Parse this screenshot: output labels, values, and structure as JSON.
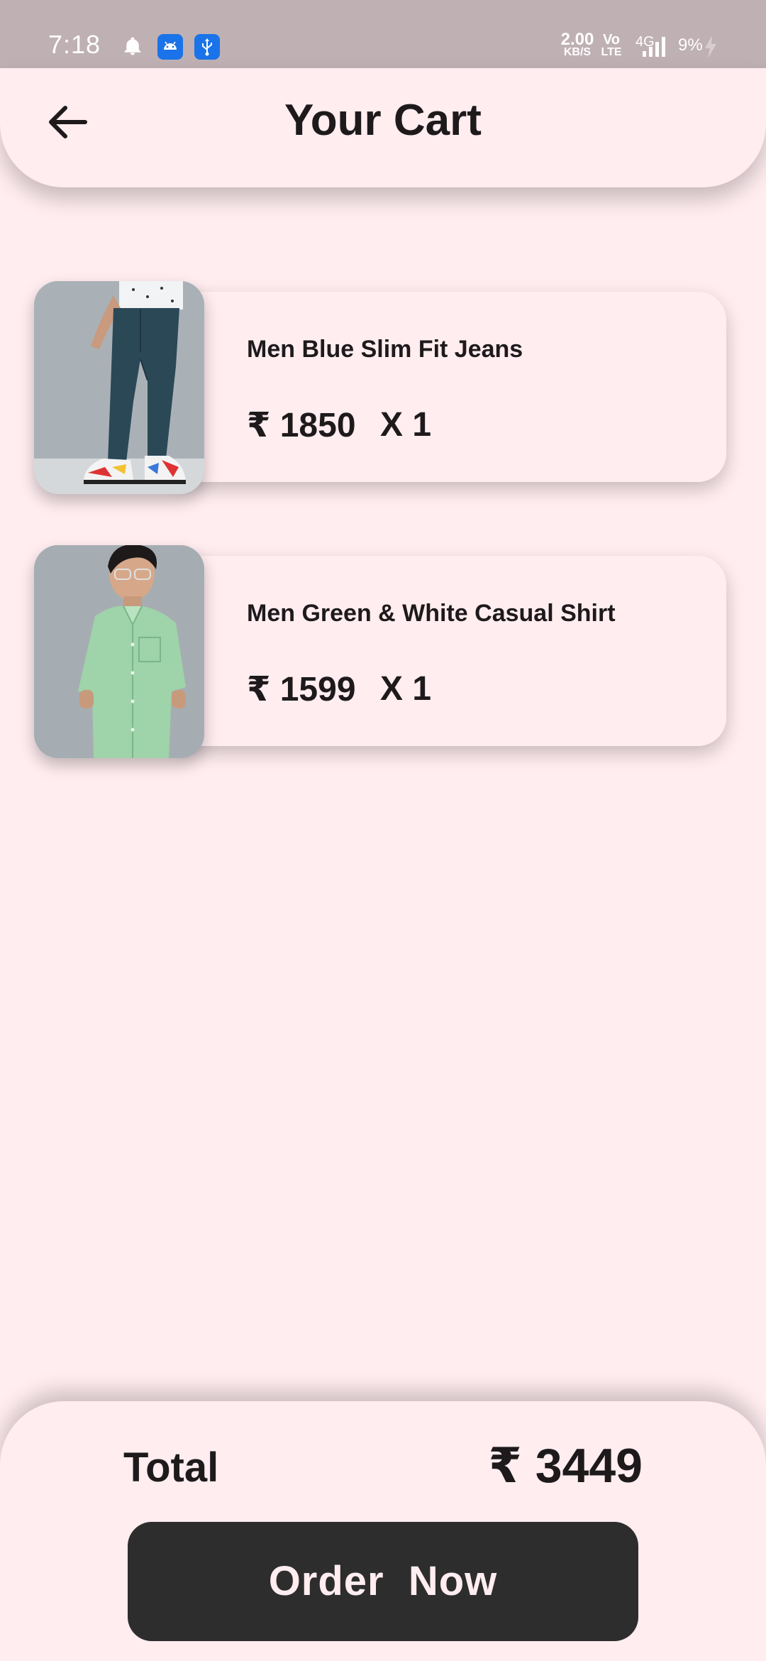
{
  "status_bar": {
    "time": "7:18",
    "speed_value": "2.00",
    "speed_unit": "KB/S",
    "volte_top": "Vo",
    "volte_bottom": "LTE",
    "network": "4G",
    "battery": "9%",
    "icons": [
      "bell-icon",
      "android-icon",
      "usb-icon",
      "signal-icon",
      "charging-icon"
    ]
  },
  "header": {
    "title": "Your Cart",
    "back_icon": "arrow-left-icon"
  },
  "cart": {
    "currency": "₹",
    "items": [
      {
        "name": "Men Blue Slim Fit Jeans",
        "price": "₹ 1850",
        "quantity": "X  1",
        "image": "jeans-product-image"
      },
      {
        "name": "Men Green & White Casual Shirt",
        "price": "₹ 1599",
        "quantity": "X  1",
        "image": "shirt-product-image"
      }
    ]
  },
  "footer": {
    "total_label": "Total",
    "total_value": "₹ 3449",
    "order_button_label": "Order  Now"
  },
  "colors": {
    "background": "#ffedf0",
    "status_bar": "#bfb0b4",
    "text": "#1e1a1c",
    "button": "#2d2d2d",
    "button_text": "#ffedf0"
  }
}
